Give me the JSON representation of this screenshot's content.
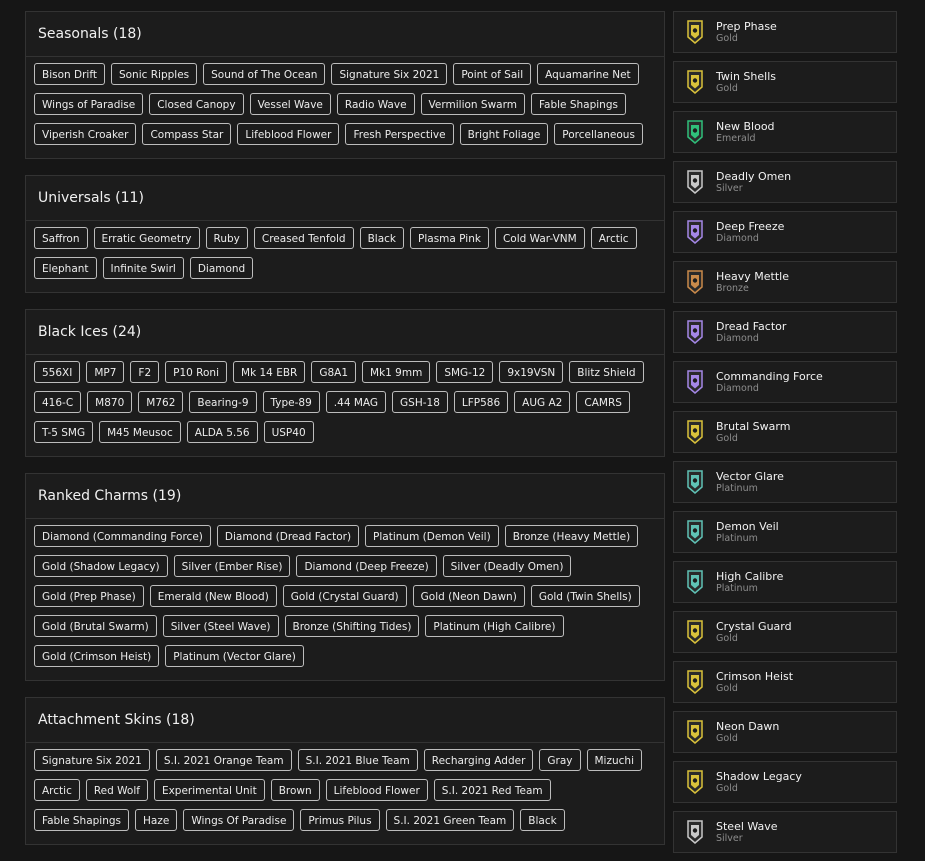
{
  "sections": [
    {
      "title": "Seasonals (18)",
      "items": [
        "Bison Drift",
        "Sonic Ripples",
        "Sound of The Ocean",
        "Signature Six 2021",
        "Point of Sail",
        "Aquamarine Net",
        "Wings of Paradise",
        "Closed Canopy",
        "Vessel Wave",
        "Radio Wave",
        "Vermilion Swarm",
        "Fable Shapings",
        "Viperish Croaker",
        "Compass Star",
        "Lifeblood Flower",
        "Fresh Perspective",
        "Bright Foliage",
        "Porcellaneous"
      ]
    },
    {
      "title": "Universals (11)",
      "items": [
        "Saffron",
        "Erratic Geometry",
        "Ruby",
        "Creased Tenfold",
        "Black",
        "Plasma Pink",
        "Cold War-VNM",
        "Arctic",
        "Elephant",
        "Infinite Swirl",
        "Diamond"
      ]
    },
    {
      "title": "Black Ices (24)",
      "items": [
        "556XI",
        "MP7",
        "F2",
        "P10 Roni",
        "Mk 14 EBR",
        "G8A1",
        "Mk1 9mm",
        "SMG-12",
        "9x19VSN",
        "Blitz Shield",
        "416-C",
        "M870",
        "M762",
        "Bearing-9",
        "Type-89",
        ".44 MAG",
        "GSH-18",
        "LFP586",
        "AUG A2",
        "CAMRS",
        "T-5 SMG",
        "M45 Meusoc",
        "ALDA 5.56",
        "USP40"
      ]
    },
    {
      "title": "Ranked Charms (19)",
      "items": [
        "Diamond (Commanding Force)",
        "Diamond (Dread Factor)",
        "Platinum (Demon Veil)",
        "Bronze (Heavy Mettle)",
        "Gold (Shadow Legacy)",
        "Silver (Ember Rise)",
        "Diamond (Deep Freeze)",
        "Silver (Deadly Omen)",
        "Gold (Prep Phase)",
        "Emerald (New Blood)",
        "Gold (Crystal Guard)",
        "Gold (Neon Dawn)",
        "Gold (Twin Shells)",
        "Gold (Brutal Swarm)",
        "Silver (Steel Wave)",
        "Bronze (Shifting Tides)",
        "Platinum (High Calibre)",
        "Gold (Crimson Heist)",
        "Platinum (Vector Glare)"
      ]
    },
    {
      "title": "Attachment Skins (18)",
      "items": [
        "Signature Six 2021",
        "S.I. 2021 Orange Team",
        "S.I. 2021 Blue Team",
        "Recharging Adder",
        "Gray",
        "Mizuchi",
        "Arctic",
        "Red Wolf",
        "Experimental Unit",
        "Brown",
        "Lifeblood Flower",
        "S.I. 2021 Red Team",
        "Fable Shapings",
        "Haze",
        "Wings Of Paradise",
        "Primus Pilus",
        "S.I. 2021 Green Team",
        "Black"
      ]
    }
  ],
  "tier_colors": {
    "Gold": "#d9c13a",
    "Emerald": "#2fbf7a",
    "Silver": "#c8c8c8",
    "Diamond": "#a487e6",
    "Bronze": "#c98a4a",
    "Platinum": "#5fc2b5"
  },
  "ranks": [
    {
      "name": "Prep Phase",
      "tier": "Gold"
    },
    {
      "name": "Twin Shells",
      "tier": "Gold"
    },
    {
      "name": "New Blood",
      "tier": "Emerald"
    },
    {
      "name": "Deadly Omen",
      "tier": "Silver"
    },
    {
      "name": "Deep Freeze",
      "tier": "Diamond"
    },
    {
      "name": "Heavy Mettle",
      "tier": "Bronze"
    },
    {
      "name": "Dread Factor",
      "tier": "Diamond"
    },
    {
      "name": "Commanding Force",
      "tier": "Diamond"
    },
    {
      "name": "Brutal Swarm",
      "tier": "Gold"
    },
    {
      "name": "Vector Glare",
      "tier": "Platinum"
    },
    {
      "name": "Demon Veil",
      "tier": "Platinum"
    },
    {
      "name": "High Calibre",
      "tier": "Platinum"
    },
    {
      "name": "Crystal Guard",
      "tier": "Gold"
    },
    {
      "name": "Crimson Heist",
      "tier": "Gold"
    },
    {
      "name": "Neon Dawn",
      "tier": "Gold"
    },
    {
      "name": "Shadow Legacy",
      "tier": "Gold"
    },
    {
      "name": "Steel Wave",
      "tier": "Silver"
    }
  ]
}
